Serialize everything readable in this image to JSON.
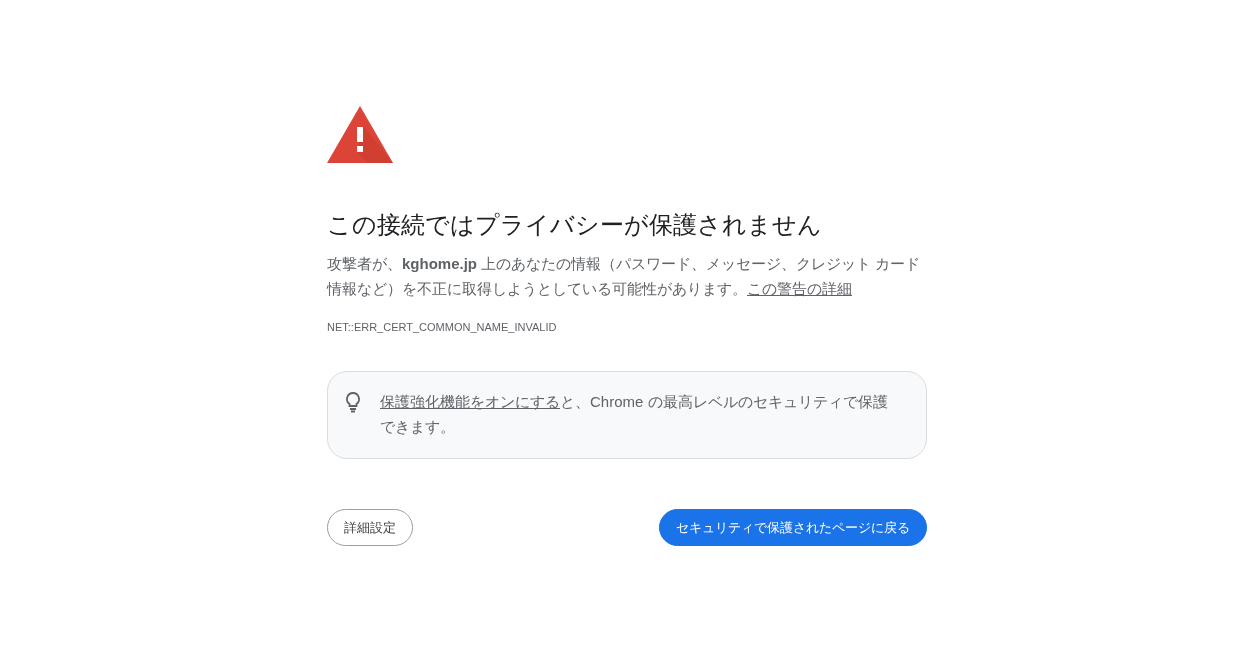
{
  "heading": "この接続ではプライバシーが保護されません",
  "explanation": {
    "text": "攻撃者が、**kghome.jp** 上のあなたの情報（パスワード、メッセージ、クレジット カード情報など）を不正に取得しようとしている可能性があります。",
    "link": "この警告の詳細"
  },
  "error_code": "NET::ERR_CERT_COMMON_NAME_INVALID",
  "protection_tip": {
    "link": "保護強化機能をオンにする",
    "text": "と、Chrome の最高レベルのセキュリティで保護できます。"
  },
  "buttons": [
    {
      "label": "詳細設定",
      "kind": "secondary"
    },
    {
      "label": "セキュリティで保護されたページに戻る",
      "kind": "primary"
    }
  ]
}
